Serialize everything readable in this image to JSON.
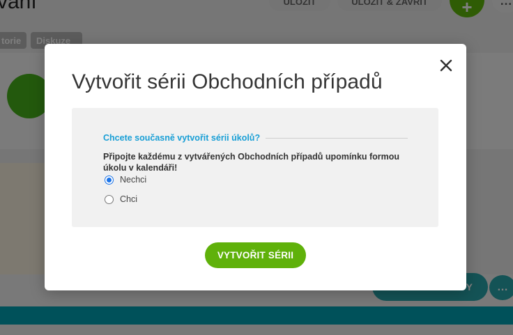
{
  "background": {
    "title": "vání",
    "buttons": {
      "save": "Uložit",
      "save_close": "Uložit & zavřít"
    },
    "more_label": "…",
    "tabs": [
      "torie",
      "Diskuze"
    ],
    "bottom_button_label": "Y"
  },
  "modal": {
    "title": "Vytvořit sérii Obchodních případů",
    "section_title": "Chcete současně vytvořit sérii úkolů?",
    "description": "Připojte každému z vytvářených Obchodních případů upomínku formou úkolu v kalendáři!",
    "options": [
      {
        "label": "Nechci",
        "selected": true
      },
      {
        "label": "Chci",
        "selected": false
      }
    ],
    "create_button": "VYTVOŘIT SÉRII"
  },
  "colors": {
    "accent_green": "#5fb10a",
    "section_blue": "#199fd6",
    "bar_teal": "#00a3b4"
  }
}
